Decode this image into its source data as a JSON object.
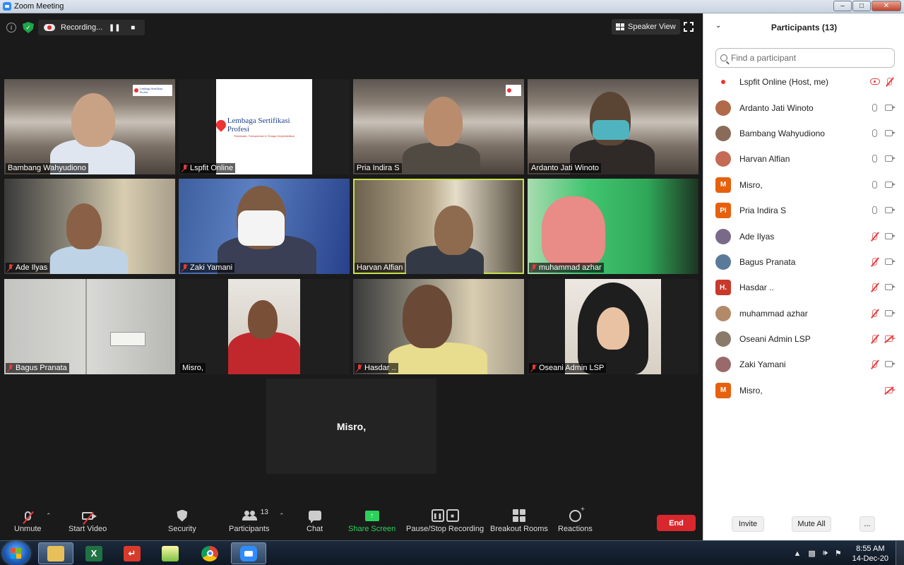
{
  "window": {
    "title": "Zoom Meeting"
  },
  "top_bar": {
    "recording_label": "Recording...",
    "view_label": "Speaker View"
  },
  "tiles": [
    {
      "name": "Bambang Wahyudiono",
      "muted": false
    },
    {
      "name": "Lspfit Online",
      "muted": true
    },
    {
      "name": "Pria Indira S",
      "muted": false
    },
    {
      "name": "Ardanto Jati Winoto",
      "muted": false
    },
    {
      "name": "Ade Ilyas",
      "muted": true
    },
    {
      "name": "Zaki Yamani",
      "muted": true
    },
    {
      "name": "Harvan Alfian",
      "muted": false
    },
    {
      "name": "muhammad azhar",
      "muted": true
    },
    {
      "name": "Bagus Pranata",
      "muted": true
    },
    {
      "name": "Misro,",
      "muted": false
    },
    {
      "name": "Hasdar ..",
      "muted": true
    },
    {
      "name": "Oseani Admin LSP",
      "muted": true
    }
  ],
  "logo_card": {
    "title": "Lembaga Sertifikasi Profesi",
    "subtitle": "Pariwisata, Transportasi & Tenaga Kependidikan"
  },
  "no_video_name": "Misro,",
  "toolbar": {
    "unmute": "Unmute",
    "start_video": "Start Video",
    "security": "Security",
    "participants": "Participants",
    "participants_count": "13",
    "chat": "Chat",
    "share_screen": "Share Screen",
    "pause_stop_recording": "Pause/Stop Recording",
    "breakout_rooms": "Breakout Rooms",
    "reactions": "Reactions",
    "end": "End"
  },
  "panel": {
    "title": "Participants (13)",
    "search_placeholder": "Find a participant",
    "participants": [
      {
        "name": "Lspfit Online (Host, me)",
        "avatar": "logo",
        "mic": "off",
        "cam": "rec"
      },
      {
        "name": "Ardanto Jati Winoto",
        "avatar": "photo",
        "mic": "on",
        "cam": "on"
      },
      {
        "name": "Bambang Wahyudiono",
        "avatar": "photo",
        "mic": "on",
        "cam": "on"
      },
      {
        "name": "Harvan Alfian",
        "avatar": "photo",
        "mic": "on",
        "cam": "on"
      },
      {
        "name": "Misro,",
        "avatar": "M",
        "mic": "on",
        "cam": "on"
      },
      {
        "name": "Pria Indira S",
        "avatar": "PI",
        "mic": "on",
        "cam": "on"
      },
      {
        "name": "Ade Ilyas",
        "avatar": "photo",
        "mic": "off",
        "cam": "on"
      },
      {
        "name": "Bagus Pranata",
        "avatar": "photo",
        "mic": "off",
        "cam": "on"
      },
      {
        "name": "Hasdar ..",
        "avatar": "H.",
        "mic": "off",
        "cam": "on"
      },
      {
        "name": "muhammad azhar",
        "avatar": "photo",
        "mic": "off",
        "cam": "on"
      },
      {
        "name": "Oseani Admin LSP",
        "avatar": "photo",
        "mic": "off",
        "cam": "off"
      },
      {
        "name": "Zaki Yamani",
        "avatar": "photo",
        "mic": "off",
        "cam": "on"
      },
      {
        "name": "Misro,",
        "avatar": "M",
        "mic": "none",
        "cam": "off"
      }
    ],
    "invite": "Invite",
    "mute_all": "Mute All",
    "more": "..."
  },
  "taskbar": {
    "time": "8:55 AM",
    "date": "14-Dec-20"
  },
  "colors": {
    "zoom_blue": "#2d8cff",
    "share_green": "#2bd15b",
    "end_red": "#d9272e",
    "active_speaker": "#c8e24a",
    "avatar_orange": "#e6600e",
    "avatar_red": "#c9392b"
  }
}
